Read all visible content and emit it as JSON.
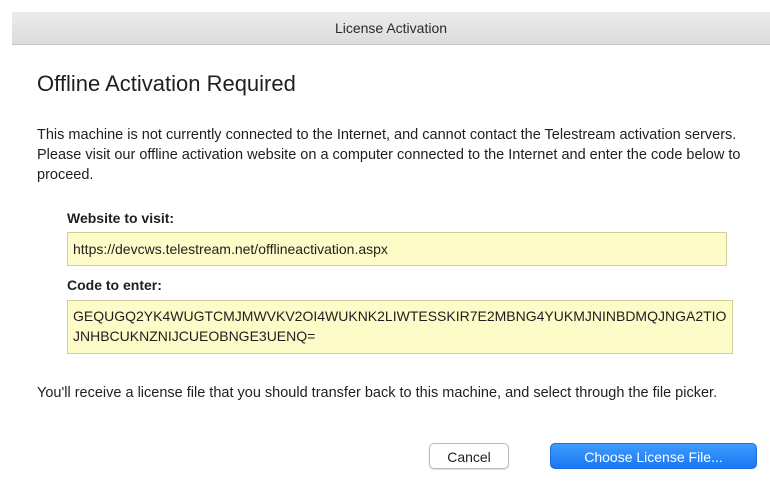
{
  "window": {
    "title": "License Activation"
  },
  "dialog": {
    "heading": "Offline Activation Required",
    "intro": "This machine is not currently connected to the Internet, and cannot contact the Telestream activation servers.  Please visit our offline activation website on a computer connected to the Internet and enter the code below to proceed.",
    "website_label": "Website to visit:",
    "website_value": "https://devcws.telestream.net/offlineactivation.aspx",
    "code_label": "Code to enter:",
    "code_value": "GEQUGQ2YK4WUGTCMJMWVKV2OI4WUKNK2LIWTESSKIR7E2MBNG4YUKMJNINBDMQJNGA2TIOJNHBCUKNZNIJCUEOBNGE3UENQ=",
    "outro": "You'll receive a license file that you should transfer back to this machine, and select through the file picker.",
    "cancel_label": "Cancel",
    "choose_label": "Choose License File..."
  },
  "colors": {
    "accent": "#1877f2",
    "field_bg": "#fdfbc7"
  }
}
